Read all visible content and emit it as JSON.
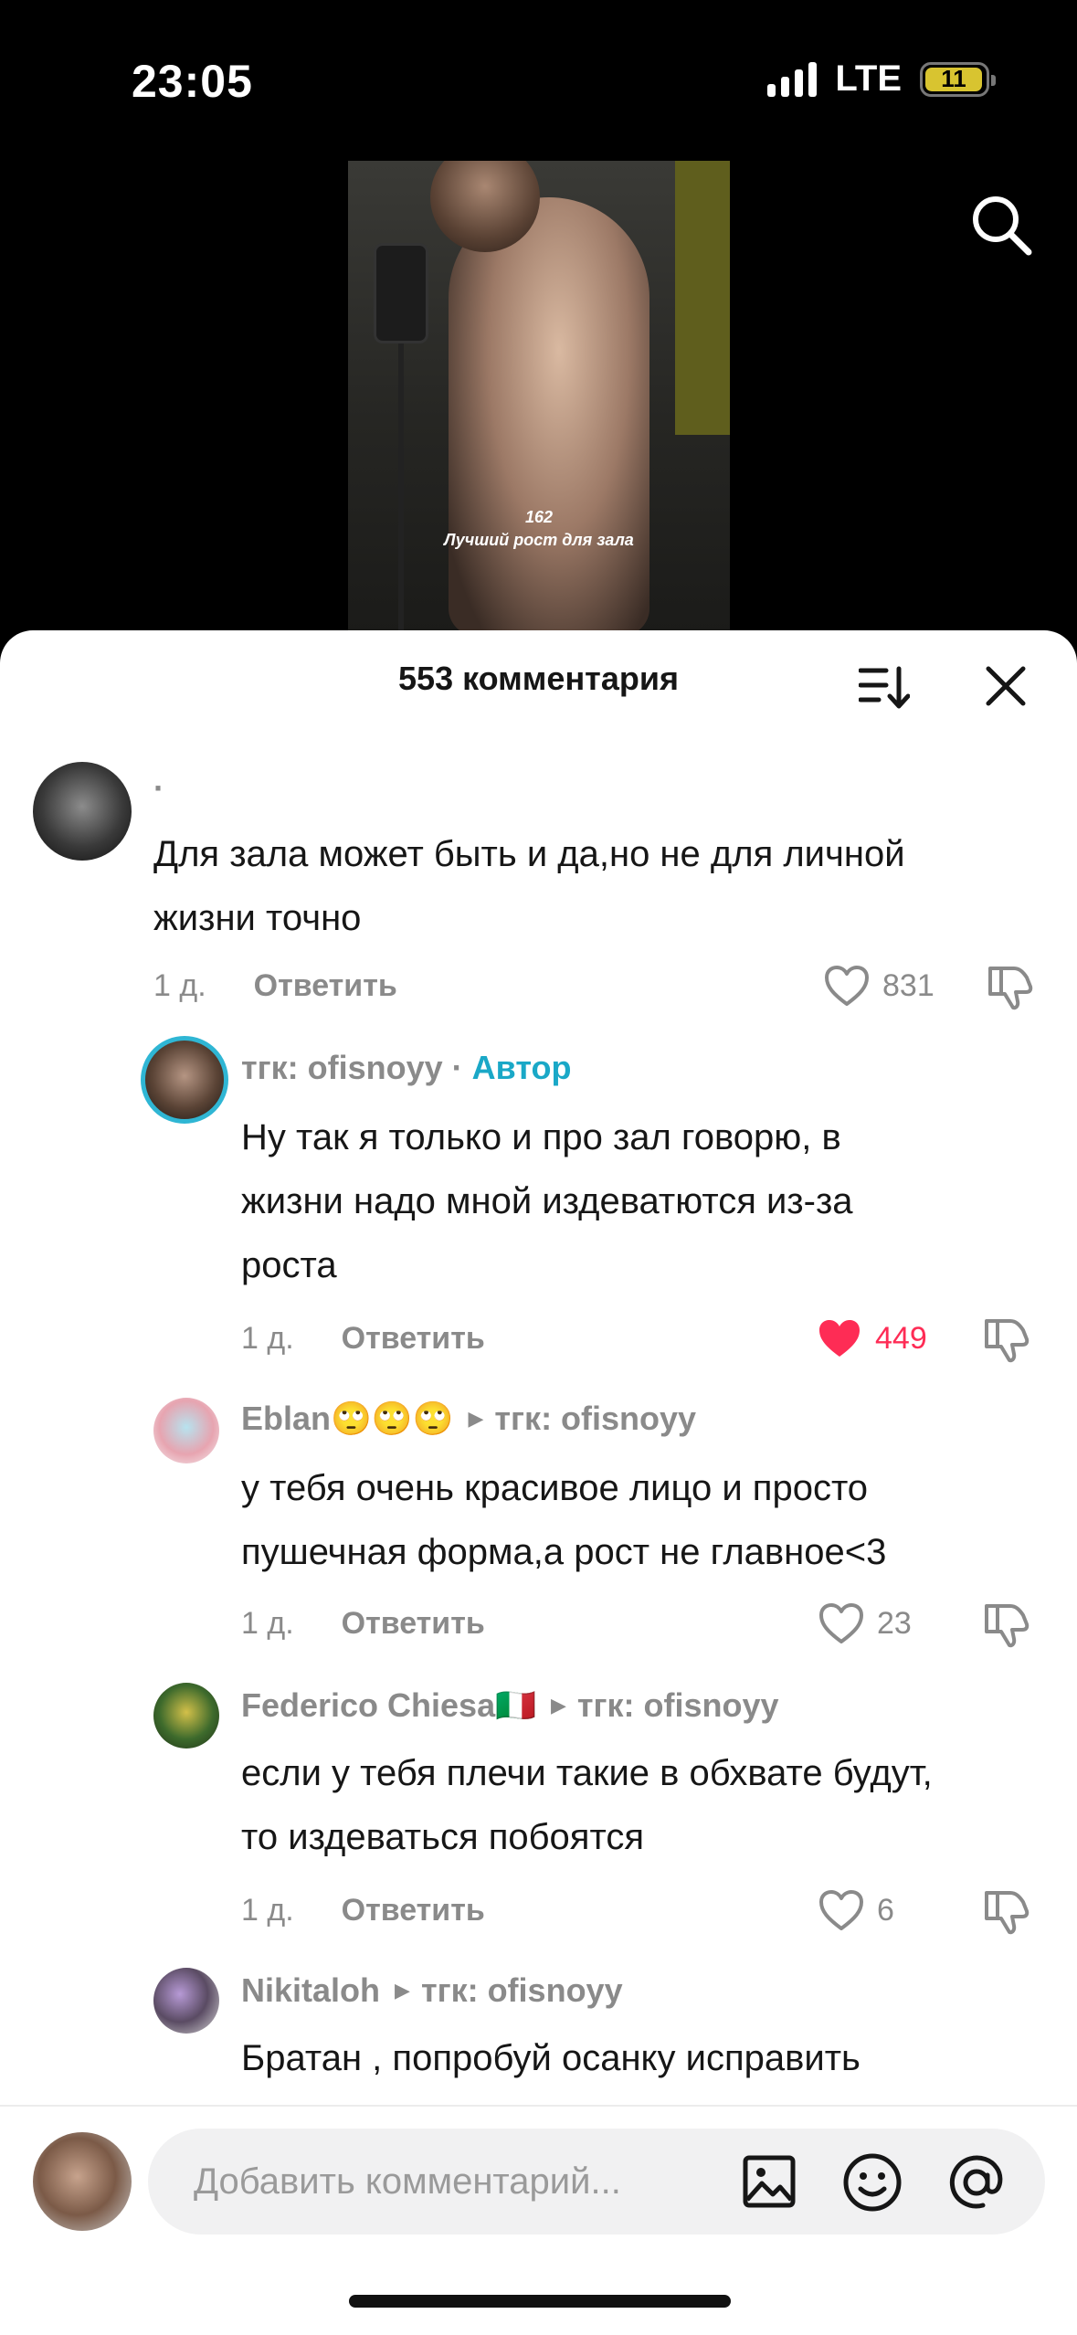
{
  "status_bar": {
    "time": "23:05",
    "network": "LTE",
    "battery": "11"
  },
  "video": {
    "caption_number": "162",
    "caption_text": "Лучший рост для зала"
  },
  "sheet": {
    "title": "553 комментария"
  },
  "comments": [
    {
      "username": "·",
      "text_line1": "Для зала может быть и да,но не для личной",
      "text_line2": "жизни точно",
      "age": "1 д.",
      "reply": "Ответить",
      "likes": "831",
      "liked": false
    },
    {
      "username": "тгк: ofisnoyy",
      "separator": "·",
      "author_label": "Автор",
      "text_line1": "Ну так я только и про зал говорю, в",
      "text_line2": "жизни надо мной издеватются из-за",
      "text_line3": "роста",
      "age": "1 д.",
      "reply": "Ответить",
      "likes": "449",
      "liked": true
    },
    {
      "username": "Eblan🙄🙄🙄",
      "reply_to": "тгк: ofisnoyy",
      "text_line1": "у тебя очень красивое лицо и просто",
      "text_line2": "пушечная форма,а рост не главное<3",
      "age": "1 д.",
      "reply": "Ответить",
      "likes": "23",
      "liked": false
    },
    {
      "username": "Federico Chiesa🇮🇹",
      "reply_to": "тгк: ofisnoyy",
      "text_line1": "если у тебя плечи такие в обхвате будут,",
      "text_line2": "то издеваться побоятся",
      "age": "1 д.",
      "reply": "Ответить",
      "likes": "6",
      "liked": false
    },
    {
      "username": "Nikitaloh",
      "reply_to": "тгк: ofisnoyy",
      "text_line1": "Братан , попробуй осанку исправить"
    }
  ],
  "input": {
    "placeholder": "Добавить комментарий..."
  },
  "colors": {
    "like_active": "#fe2c55",
    "author": "#1aa8c7",
    "muted": "#8a8a8a"
  }
}
